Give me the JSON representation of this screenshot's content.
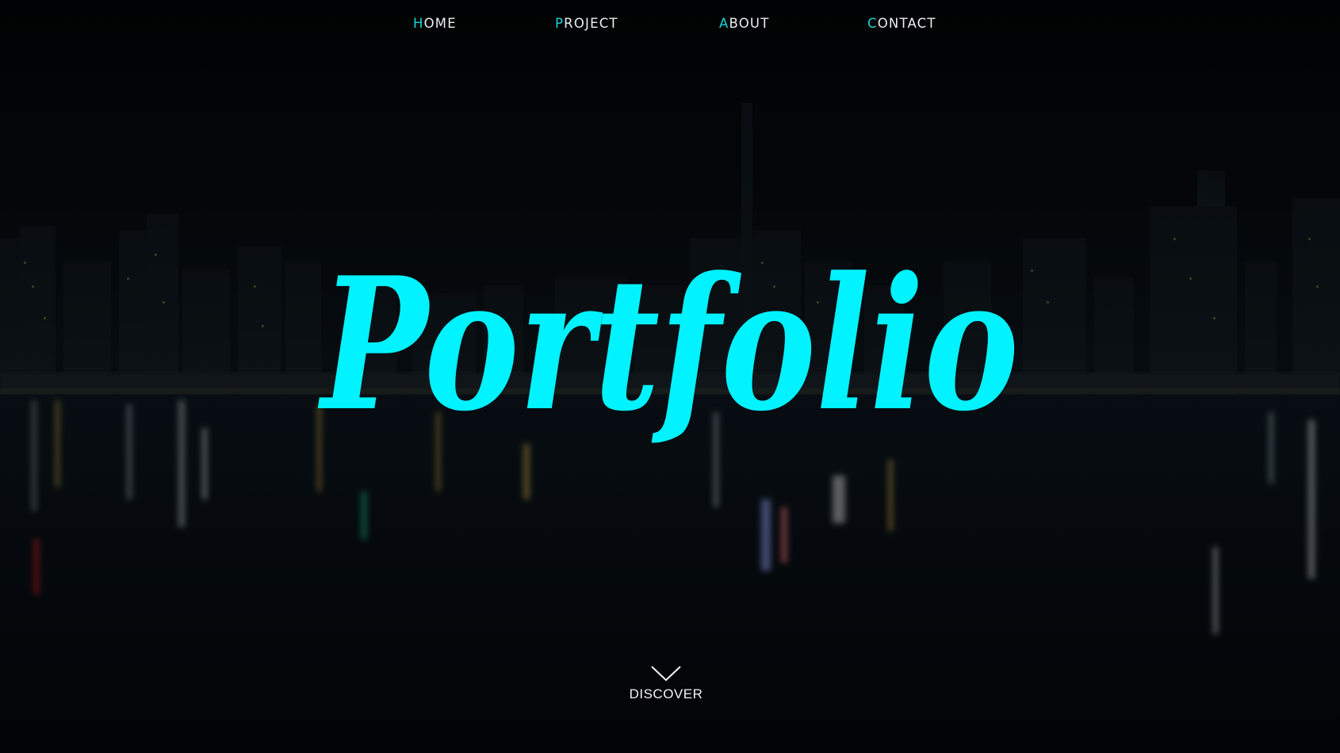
{
  "nav": {
    "items": [
      {
        "initial": "H",
        "rest": "OME"
      },
      {
        "initial": "P",
        "rest": "ROJECT"
      },
      {
        "initial": "A",
        "rest": "BOUT"
      },
      {
        "initial": "C",
        "rest": "ONTACT"
      }
    ]
  },
  "hero": {
    "title": "Portfolio"
  },
  "discover": {
    "label": "DISCOVER",
    "icon": "chevron-down-icon"
  },
  "colors": {
    "accent": "#00f3ff",
    "nav_initial": "#19d6d9",
    "text": "#e9eef2",
    "background": "#05080b"
  },
  "background_image": "night-city-skyline-reflection"
}
